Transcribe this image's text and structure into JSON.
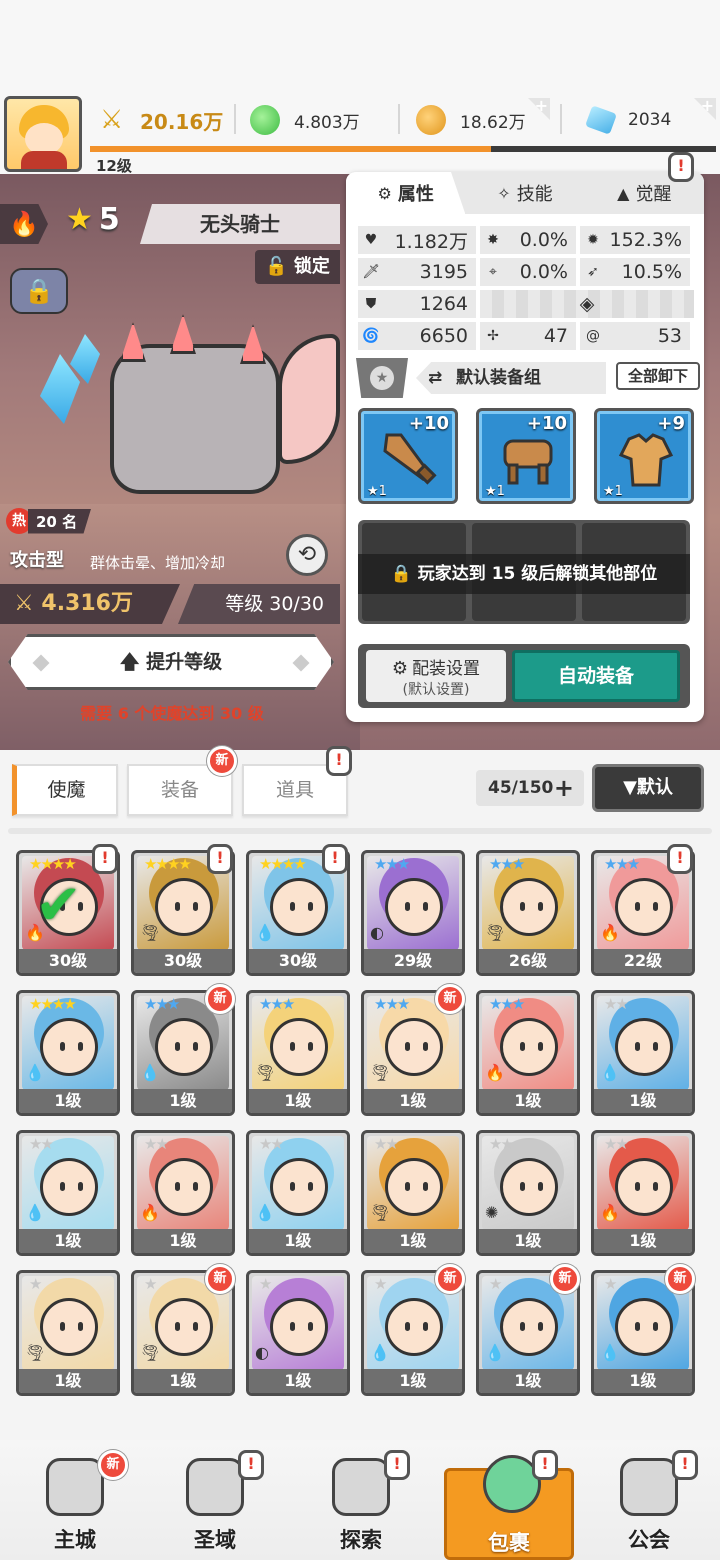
{
  "topbar": {
    "power": "20.16万",
    "green_gem": "4.803万",
    "gold": "18.62万",
    "diamond": "2034",
    "player_level": "12级",
    "xp_progress": 0.64
  },
  "hero": {
    "star_count": "5",
    "name": "无头骑士",
    "lock_label": "锁定",
    "hot_label": "热",
    "rank_label": "20 名",
    "type": "攻击型",
    "type_desc": "群体击晕、增加冷却",
    "power": "4.316万",
    "level_text": "等级 30/30",
    "levelup_label": "提升等级",
    "requirement": "需要 6 个使魔达到 30 级"
  },
  "attr_panel": {
    "tabs": [
      {
        "label": "属性",
        "icon": "gear-icon"
      },
      {
        "label": "技能",
        "icon": "magic-icon"
      },
      {
        "label": "觉醒",
        "icon": "awaken-icon"
      }
    ],
    "attrs": {
      "hp": "1.182万",
      "crit": "0.0%",
      "crit_dmg": "152.3%",
      "atk": "3195",
      "accuracy": "0.0%",
      "dodge": "10.5%",
      "def": "1264",
      "speed": "6650",
      "skill_a": "47",
      "skill_b": "53"
    },
    "equip_set_label": "默认装备组",
    "unequip_all": "全部卸下",
    "slots": [
      {
        "plus": "+10",
        "stars": "★1",
        "item": "sword"
      },
      {
        "plus": "+10",
        "stars": "★1",
        "item": "helmet"
      },
      {
        "plus": "+9",
        "stars": "★1",
        "item": "armor"
      }
    ],
    "lock_message": "玩家达到 15 级后解锁其他部位",
    "config_label": "配装设置",
    "config_sub": "(默认设置)",
    "auto_equip": "自动装备"
  },
  "inventory": {
    "tabs": [
      "使魔",
      "装备",
      "道具"
    ],
    "new_label": "新",
    "count": "45/150",
    "sort_label": "▼默认",
    "cards": [
      {
        "level": "30级",
        "stars": 4,
        "elem": "fire",
        "color": "#c44a52",
        "alert": true,
        "new": false,
        "checked": true
      },
      {
        "level": "30级",
        "stars": 4,
        "elem": "wind",
        "color": "#c99a3c",
        "alert": true,
        "new": false
      },
      {
        "level": "30级",
        "stars": 4,
        "elem": "water",
        "color": "#7fc4e8",
        "alert": true,
        "new": false
      },
      {
        "level": "29级",
        "stars": 3,
        "elem": "dark",
        "color": "#9b6fd1",
        "alert": false,
        "new": false
      },
      {
        "level": "26级",
        "stars": 3,
        "elem": "wind",
        "color": "#e0b44c",
        "alert": false,
        "new": false
      },
      {
        "level": "22级",
        "stars": 3,
        "elem": "fire",
        "color": "#f09a9a",
        "alert": true,
        "new": false
      },
      {
        "level": "1级",
        "stars": 4,
        "elem": "water",
        "color": "#6ab8e6",
        "alert": false,
        "new": false
      },
      {
        "level": "1级",
        "stars": 3,
        "elem": "water",
        "color": "#8a8a8a",
        "alert": false,
        "new": true
      },
      {
        "level": "1级",
        "stars": 3,
        "elem": "wind",
        "color": "#f4d27a",
        "alert": false,
        "new": false
      },
      {
        "level": "1级",
        "stars": 3,
        "elem": "wind",
        "color": "#f7d9a8",
        "alert": false,
        "new": true
      },
      {
        "level": "1级",
        "stars": 3,
        "elem": "fire",
        "color": "#f08c84",
        "alert": false,
        "new": false
      },
      {
        "level": "1级",
        "stars": 2,
        "elem": "water",
        "color": "#5fb0e6",
        "alert": false,
        "new": false
      },
      {
        "level": "1级",
        "stars": 2,
        "elem": "water",
        "color": "#a6dcef",
        "alert": false,
        "new": false
      },
      {
        "level": "1级",
        "stars": 2,
        "elem": "fire",
        "color": "#e8857a",
        "alert": false,
        "new": false
      },
      {
        "level": "1级",
        "stars": 2,
        "elem": "water",
        "color": "#8fd1ef",
        "alert": false,
        "new": false
      },
      {
        "level": "1级",
        "stars": 2,
        "elem": "wind",
        "color": "#e6a23c",
        "alert": false,
        "new": false
      },
      {
        "level": "1级",
        "stars": 2,
        "elem": "light",
        "color": "#c9c9c9",
        "alert": false,
        "new": false
      },
      {
        "level": "1级",
        "stars": 2,
        "elem": "fire",
        "color": "#e45a4a",
        "alert": false,
        "new": false
      },
      {
        "level": "1级",
        "stars": 1,
        "elem": "wind",
        "color": "#f2d9a8",
        "alert": false,
        "new": false
      },
      {
        "level": "1级",
        "stars": 1,
        "elem": "wind",
        "color": "#f2d9a8",
        "alert": false,
        "new": true
      },
      {
        "level": "1级",
        "stars": 1,
        "elem": "dark",
        "color": "#b77fd6",
        "alert": false,
        "new": false
      },
      {
        "level": "1级",
        "stars": 1,
        "elem": "water",
        "color": "#9fd4f0",
        "alert": false,
        "new": true
      },
      {
        "level": "1级",
        "stars": 1,
        "elem": "water",
        "color": "#6cb7e8",
        "alert": false,
        "new": true
      },
      {
        "level": "1级",
        "stars": 1,
        "elem": "water",
        "color": "#4fa6e2",
        "alert": false,
        "new": true
      }
    ]
  },
  "bottom_nav": [
    {
      "label": "主城",
      "icon": "castle-icon",
      "badge": "new"
    },
    {
      "label": "圣域",
      "icon": "vortex-icon",
      "badge": "alert"
    },
    {
      "label": "探索",
      "icon": "sword-stone-icon",
      "badge": "alert"
    },
    {
      "label": "包裹",
      "icon": "bag-icon",
      "badge": "alert",
      "active": true
    },
    {
      "label": "公会",
      "icon": "guild-icon",
      "badge": "alert"
    }
  ],
  "colors": {
    "accent_orange": "#f2922b",
    "auto_equip_teal": "#1c9b8a",
    "warning_red": "#e0432a"
  }
}
